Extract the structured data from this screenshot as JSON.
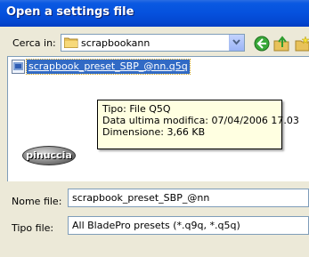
{
  "window": {
    "title": "Open a settings file"
  },
  "lookin": {
    "label": "Cerca in:",
    "value": "scrapbookann"
  },
  "files": [
    {
      "name": "scrapbook_preset_SBP_@nn.q5q"
    }
  ],
  "tooltip": {
    "type": "Tipo: File Q5Q",
    "modified": "Data ultima modifica: 07/04/2006 17.03",
    "size": "Dimensione: 3,66 KB"
  },
  "watermark": {
    "text": "pinuccia"
  },
  "filename": {
    "label": "Nome file:",
    "value": "scrapbook_preset_SBP_@nn"
  },
  "filetype": {
    "label": "Tipo file:",
    "value": "All BladePro presets (*.q9q, *.q5q)"
  },
  "colors": {
    "titlebar": "#0551dd",
    "selection": "#316ac5",
    "tooltip_bg": "#ffffe1"
  }
}
